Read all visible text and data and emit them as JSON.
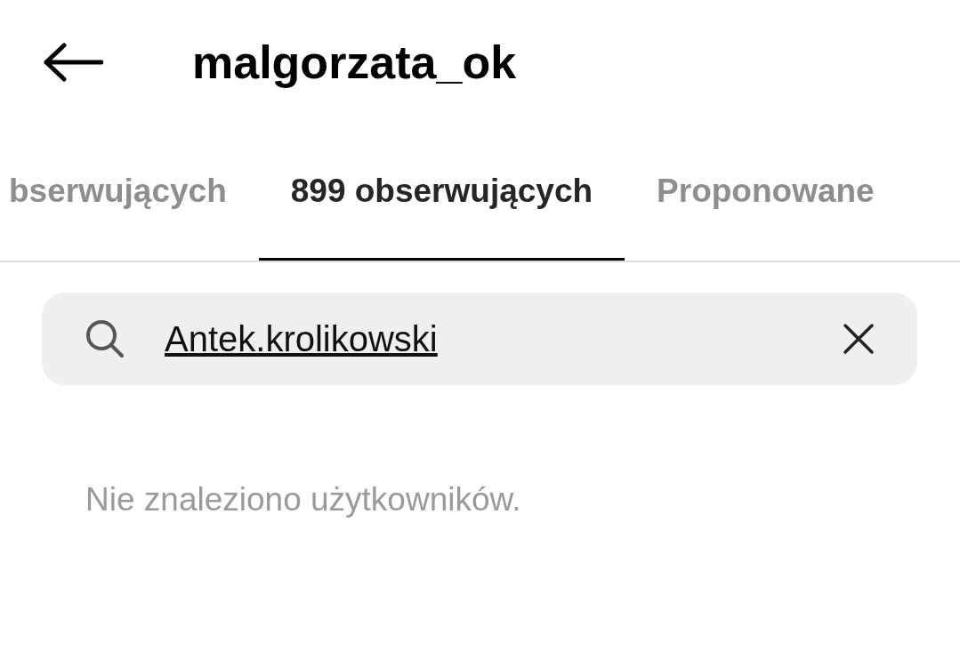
{
  "header": {
    "title": "malgorzata_ok"
  },
  "tabs": [
    {
      "label": "bserwujących",
      "selected": false
    },
    {
      "label": "899 obserwujących",
      "selected": true
    },
    {
      "label": "Proponowane",
      "selected": false
    }
  ],
  "search": {
    "value": "Antek.krolikowski"
  },
  "empty_message": "Nie znaleziono użytkowników."
}
